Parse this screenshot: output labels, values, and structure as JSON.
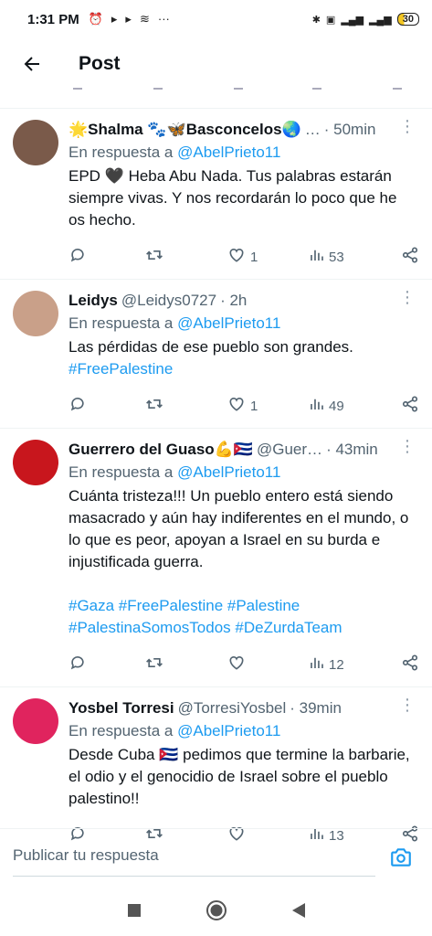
{
  "status_bar": {
    "time": "1:31 PM",
    "battery": "30"
  },
  "header": {
    "title": "Post"
  },
  "posts": [
    {
      "name": "🌟Shalma 🐾🦋Basconcelos🌏",
      "handle": "…",
      "time": "· 50min",
      "reply_label": "En respuesta a",
      "reply_mention": "@AbelPrieto11",
      "text": "EPD 🖤 Heba Abu Nada. Tus palabras estarán siempre vivas. Y nos recordarán lo poco que he os hecho.",
      "hashtags": "",
      "likes": "1",
      "views": "53",
      "avatar_color": "#7a5a4a"
    },
    {
      "name": "Leidys",
      "handle": "@Leidys0727",
      "time": "· 2h",
      "reply_label": "En respuesta a",
      "reply_mention": "@AbelPrieto11",
      "text": "Las pérdidas de ese pueblo son grandes.",
      "hashtags": "#FreePalestine",
      "likes": "1",
      "views": "49",
      "avatar_color": "#c9a089"
    },
    {
      "name": "Guerrero del Guaso💪🇨🇺",
      "handle": "@Guer…",
      "time": "· 43min",
      "reply_label": "En respuesta a",
      "reply_mention": "@AbelPrieto11",
      "text": "Cuánta tristeza!!! Un pueblo entero está siendo masacrado y aún hay indiferentes en el mundo, o lo que es peor, apoyan a Israel en su burda e injustificada guerra.",
      "hashtags": "#Gaza #FreePalestine #Palestine #PalestinaSomosTodos #DeZurdaTeam",
      "likes": "",
      "views": "12",
      "avatar_color": "#c8161d"
    },
    {
      "name": "Yosbel Torresi",
      "handle": "@TorresiYosbel",
      "time": "· 39min",
      "reply_label": "En respuesta a",
      "reply_mention": "@AbelPrieto11",
      "text": "Desde Cuba 🇨🇺 pedimos que termine la barbarie, el odio y el genocidio de Israel sobre el pueblo palestino!!",
      "hashtags": "",
      "likes": "",
      "views": "13",
      "avatar_color": "#e0245e"
    }
  ],
  "reply_bar": {
    "placeholder": "Publicar tu respuesta"
  },
  "colors": {
    "accent": "#1d9bf0",
    "secondary_text": "#536471"
  }
}
